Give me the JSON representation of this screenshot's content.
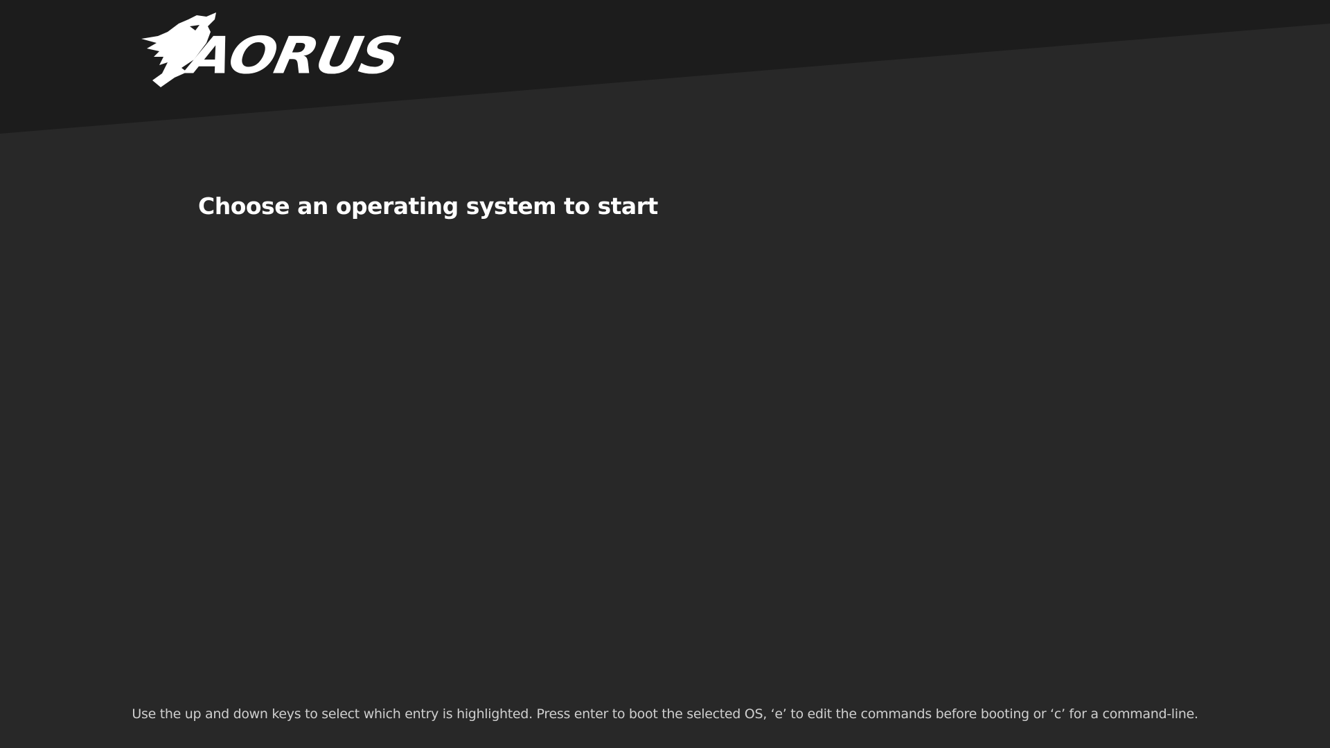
{
  "brand": {
    "logo_text": "AORUS",
    "logo_icon": "eagle-head-icon"
  },
  "menu": {
    "title": "Choose an operating system to start",
    "entries": []
  },
  "footer": {
    "help_text": "Use the up and down keys to select which entry is highlighted. Press enter to boot the selected OS, ‘e’ to edit the commands before booting or ‘c’ for a command-line."
  },
  "colors": {
    "background": "#282828",
    "header_band": "#1c1c1c",
    "text_primary": "#ffffff",
    "text_secondary": "#cfcfcf"
  }
}
